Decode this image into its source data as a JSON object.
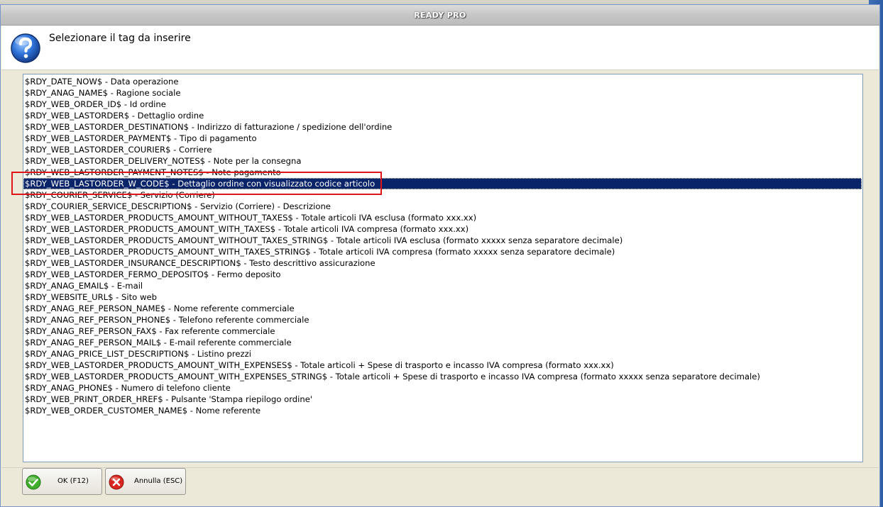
{
  "window": {
    "title": "READY PRO"
  },
  "header": {
    "text": "Selezionare il tag da inserire",
    "icon": "question-icon"
  },
  "list": {
    "selected_index": 9,
    "items": [
      "$RDY_DATE_NOW$ - Data operazione",
      "$RDY_ANAG_NAME$ - Ragione sociale",
      "$RDY_WEB_ORDER_ID$ - Id ordine",
      "$RDY_WEB_LASTORDER$ - Dettaglio ordine",
      "$RDY_WEB_LASTORDER_DESTINATION$ - Indirizzo di fatturazione / spedizione dell'ordine",
      "$RDY_WEB_LASTORDER_PAYMENT$ - Tipo di pagamento",
      "$RDY_WEB_LASTORDER_COURIER$ - Corriere",
      "$RDY_WEB_LASTORDER_DELIVERY_NOTES$ - Note per la consegna",
      "$RDY_WEB_LASTORDER_PAYMENT_NOTES$ - Note pagamento",
      "$RDY_WEB_LASTORDER_W_CODE$ - Dettaglio ordine con visualizzato codice articolo",
      "$RDY_COURIER_SERVICE$ - Servizio (Corriere)",
      "$RDY_COURIER_SERVICE_DESCRIPTION$ - Servizio (Corriere) - Descrizione",
      "$RDY_WEB_LASTORDER_PRODUCTS_AMOUNT_WITHOUT_TAXES$ - Totale articoli IVA esclusa (formato xxx.xx)",
      "$RDY_WEB_LASTORDER_PRODUCTS_AMOUNT_WITH_TAXES$ - Totale articoli IVA compresa (formato xxx.xx)",
      "$RDY_WEB_LASTORDER_PRODUCTS_AMOUNT_WITHOUT_TAXES_STRING$ - Totale articoli IVA esclusa (formato xxxxx senza separatore decimale)",
      "$RDY_WEB_LASTORDER_PRODUCTS_AMOUNT_WITH_TAXES_STRING$ - Totale articoli IVA compresa (formato xxxxx senza separatore decimale)",
      "$RDY_WEB_LASTORDER_INSURANCE_DESCRIPTION$ - Testo descrittivo assicurazione",
      "$RDY_WEB_LASTORDER_FERMO_DEPOSITO$ - Fermo deposito",
      "$RDY_ANAG_EMAIL$ - E-mail",
      "$RDY_WEBSITE_URL$ - Sito web",
      "$RDY_ANAG_REF_PERSON_NAME$ - Nome referente commerciale",
      "$RDY_ANAG_REF_PERSON_PHONE$ - Telefono referente commerciale",
      "$RDY_ANAG_REF_PERSON_FAX$ - Fax referente commerciale",
      "$RDY_ANAG_REF_PERSON_MAIL$ - E-mail referente commerciale",
      "$RDY_ANAG_PRICE_LIST_DESCRIPTION$ - Listino prezzi",
      "$RDY_WEB_LASTORDER_PRODUCTS_AMOUNT_WITH_EXPENSES$ - Totale articoli + Spese di trasporto e incasso IVA compresa (formato xxx.xx)",
      "$RDY_WEB_LASTORDER_PRODUCTS_AMOUNT_WITH_EXPENSES_STRING$ - Totale articoli + Spese di trasporto e incasso IVA compresa (formato xxxxx senza separatore decimale)",
      "$RDY_ANAG_PHONE$ - Numero di telefono cliente",
      "$RDY_WEB_PRINT_ORDER_HREF$ - Pulsante 'Stampa riepilogo ordine'",
      "$RDY_WEB_ORDER_CUSTOMER_NAME$ - Nome referente"
    ]
  },
  "buttons": {
    "ok": {
      "label": "OK (F12)",
      "icon": "check-icon"
    },
    "cancel": {
      "label": "Annulla (ESC)",
      "icon": "cancel-icon"
    }
  },
  "colors": {
    "selection": "#0a246a",
    "highlight_box": "#e0151a",
    "icon_blue": "#2f73d9",
    "ok_green": "#3fae2a",
    "cancel_red": "#d8261e"
  }
}
